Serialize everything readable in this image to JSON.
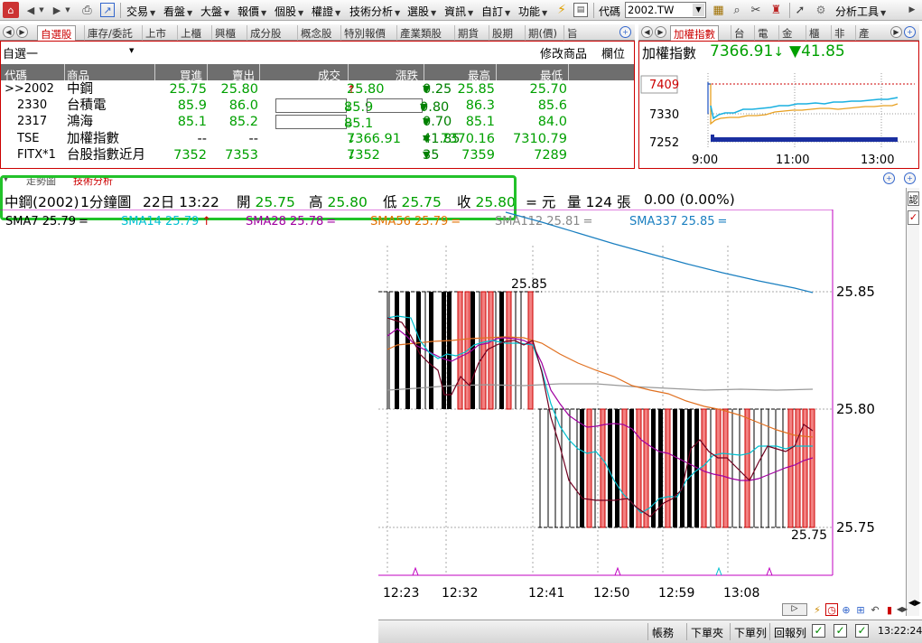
{
  "toolbar": {
    "menus": [
      "交易",
      "看盤",
      "大盤",
      "報價",
      "個股",
      "權證",
      "技術分析",
      "選股",
      "資訊",
      "自訂",
      "功能"
    ],
    "code_label": "代碼",
    "code_value": "2002.TW",
    "analysis_tools": "分析工具"
  },
  "quote_tabs": [
    "自選股",
    "庫存/委託",
    "上市",
    "上櫃",
    "興櫃",
    "成分股",
    "概念股",
    "特別報價",
    "產業類股",
    "期貨",
    "股期",
    "期(價)",
    "旨"
  ],
  "quote_panel": {
    "list_name": "自選一",
    "modify_label": "修改商品",
    "columns_label": "欄位",
    "headers": [
      "代碼",
      "商品",
      "買進",
      "賣出",
      "成交",
      "漲跌",
      "最高",
      "最低"
    ],
    "rows": [
      {
        "code": ">>2002",
        "name": "中鋼",
        "bid": "25.75",
        "ask": "25.80",
        "last": "25.80",
        "last_dir": "↑",
        "chg_dir": "▼",
        "chg": "0.25",
        "high": "25.85",
        "low": "25.70"
      },
      {
        "code": "2330",
        "name": "台積電",
        "bid": "85.9",
        "ask": "86.0",
        "last": "85.9",
        "last_dir": "↓",
        "chg_dir": "▼",
        "chg": "0.80",
        "high": "86.3",
        "low": "85.6"
      },
      {
        "code": "2317",
        "name": "鴻海",
        "bid": "85.1",
        "ask": "85.2",
        "last": "85.1",
        "last_dir": "=",
        "chg_dir": "▼",
        "chg": "0.70",
        "high": "85.1",
        "low": "84.0"
      },
      {
        "code": "TSE",
        "name": "加權指數",
        "bid": "--",
        "ask": "--",
        "last": "7366.91",
        "last_dir": "↓",
        "chg_dir": "▼",
        "chg": "41.85",
        "high": "7370.16",
        "low": "7310.79"
      },
      {
        "code": "FITX*1",
        "name": "台股指數近月",
        "bid": "7352",
        "ask": "7353",
        "last": "7352",
        "last_dir": "↓",
        "chg_dir": "▼",
        "chg": "35",
        "high": "7359",
        "low": "7289"
      }
    ]
  },
  "index_tabs": [
    "加權指數",
    "台",
    "電",
    "金",
    "櫃",
    "非",
    "產"
  ],
  "index_panel": {
    "name": "加權指數",
    "value": "7366.91",
    "value_dir": "↓",
    "chg": "▼41.85",
    "y_labels": [
      "7409",
      "7330",
      "7252"
    ],
    "x_labels": [
      "9:00",
      "11:00",
      "13:00"
    ]
  },
  "tech_tabs": [
    "走勢圖",
    "技術分析"
  ],
  "tech_header": {
    "name": "中鋼(2002)",
    "period": "1分鐘圖",
    "day": "22日 13:22",
    "open_label": "開",
    "open": "25.75",
    "high_label": "高",
    "high": "25.80",
    "low_label": "低",
    "low": "25.75",
    "close_label": "收",
    "close": "25.80",
    "unit": "= 元",
    "vol_label": "量",
    "vol": "124",
    "vol_unit": "張",
    "change": "0.00 (0.00%)"
  },
  "sma": [
    {
      "label": "SMA7 25.79",
      "dir": "=",
      "color": "#000000"
    },
    {
      "label": "SMA14 25.79",
      "dir": "↑",
      "color": "#00c0d0"
    },
    {
      "label": "SMA28 25.78",
      "dir": "=",
      "color": "#a000a0"
    },
    {
      "label": "SMA56 25.79",
      "dir": "=",
      "color": "#e07000"
    },
    {
      "label": "SMA112 25.81",
      "dir": "=",
      "color": "#888888"
    },
    {
      "label": "SMA337 25.85",
      "dir": "=",
      "color": "#1a7fc0"
    }
  ],
  "price_chart": {
    "y_labels": [
      "25.85",
      "25.80",
      "25.75"
    ],
    "hi_label": "25.85",
    "lo_label": "25.75",
    "x_labels": [
      "12:23",
      "12:32",
      "12:41",
      "12:50",
      "12:59",
      "13:08"
    ]
  },
  "status": {
    "buttons": [
      "帳務",
      "下單夾",
      "下單列",
      "回報列"
    ],
    "time": "13:22:24"
  },
  "colors": {
    "highlight": "#22c22a",
    "up": "#d00000",
    "down": "#008000",
    "bar_red": "#f28080",
    "panel_border": "#c00000"
  }
}
